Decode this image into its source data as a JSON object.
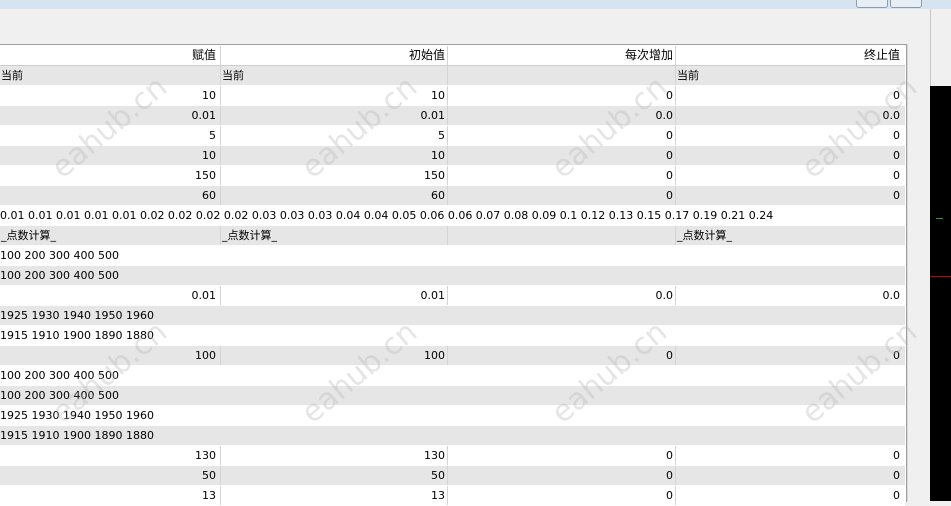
{
  "columns": [
    "赋值",
    "初始值",
    "每次增加",
    "终止值"
  ],
  "rows": [
    {
      "c": [
        "当前",
        "当前",
        "",
        "当前"
      ],
      "bg": "alt",
      "align": "left"
    },
    {
      "c": [
        "10",
        "10",
        "0",
        "0"
      ],
      "bg": "white"
    },
    {
      "c": [
        "0.01",
        "0.01",
        "0.0",
        "0.0"
      ],
      "bg": "alt"
    },
    {
      "c": [
        "5",
        "5",
        "0",
        "0"
      ],
      "bg": "white"
    },
    {
      "c": [
        "10",
        "10",
        "0",
        "0"
      ],
      "bg": "alt"
    },
    {
      "c": [
        "150",
        "150",
        "0",
        "0"
      ],
      "bg": "white"
    },
    {
      "c": [
        "60",
        "60",
        "0",
        "0"
      ],
      "bg": "alt"
    },
    {
      "span": "0.01 0.01 0.01 0.01 0.01 0.02 0.02 0.02 0.02 0.03 0.03 0.03 0.04 0.04 0.05 0.06 0.06 0.07 0.08 0.09 0.1 0.12 0.13 0.15 0.17 0.19 0.21 0.24",
      "bg": "white"
    },
    {
      "c": [
        "_点数计算_",
        "_点数计算_",
        "",
        "_点数计算_"
      ],
      "bg": "alt",
      "align": "left"
    },
    {
      "span": "100 200 300 400 500",
      "bg": "white"
    },
    {
      "span": "100 200 300 400 500",
      "bg": "alt"
    },
    {
      "c": [
        "0.01",
        "0.01",
        "0.0",
        "0.0"
      ],
      "bg": "white"
    },
    {
      "span": "1925 1930 1940 1950 1960",
      "bg": "alt"
    },
    {
      "span": "1915 1910 1900 1890 1880",
      "bg": "white"
    },
    {
      "c": [
        "100",
        "100",
        "0",
        "0"
      ],
      "bg": "alt"
    },
    {
      "span": "100 200 300 400 500",
      "bg": "white"
    },
    {
      "span": "100 200 300 400 500",
      "bg": "alt"
    },
    {
      "span": "1925 1930 1940 1950 1960",
      "bg": "white"
    },
    {
      "span": "1915 1910 1900 1890 1880",
      "bg": "alt"
    },
    {
      "c": [
        "130",
        "130",
        "0",
        "0"
      ],
      "bg": "white"
    },
    {
      "c": [
        "50",
        "50",
        "0",
        "0"
      ],
      "bg": "alt"
    },
    {
      "c": [
        "13",
        "13",
        "0",
        "0"
      ],
      "bg": "white"
    }
  ],
  "watermark": "eahub.cn"
}
